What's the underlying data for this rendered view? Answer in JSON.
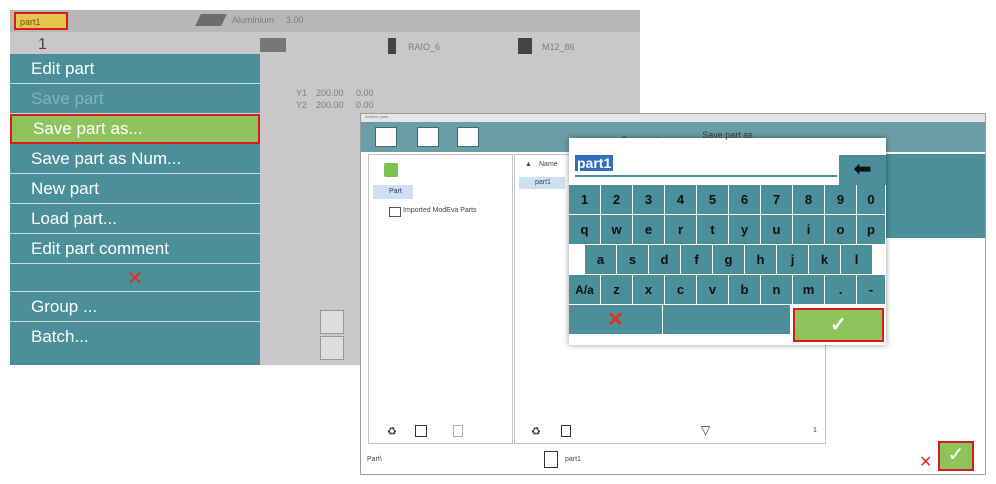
{
  "left": {
    "part_tag": "part1",
    "material_name": "Aluminium",
    "material_thickness": "3.00",
    "tool_radius": "RAIO_6",
    "tool_name": "M12_86",
    "step_number": "1",
    "y1_label": "Y1",
    "y1_value": "200.00",
    "y1_extra": "0.00",
    "y2_label": "Y2",
    "y2_value": "200.00",
    "y2_extra": "0.00",
    "menu": [
      {
        "label": "Edit part",
        "state": "normal"
      },
      {
        "label": "Save part",
        "state": "disabled"
      },
      {
        "label": "Save part as...",
        "state": "selected"
      },
      {
        "label": "Save part as Num...",
        "state": "normal"
      },
      {
        "label": "New part",
        "state": "normal"
      },
      {
        "label": "Load part...",
        "state": "normal"
      },
      {
        "label": "Edit part comment",
        "state": "normal"
      },
      {
        "label": "✕",
        "state": "close"
      },
      {
        "label": "Group ...",
        "state": "normal"
      },
      {
        "label": "Batch...",
        "state": "normal"
      }
    ]
  },
  "right": {
    "window_title": "Archive parts",
    "dialog_title": "Save part as",
    "tree_root": "Part",
    "tree_child": "Imported ModEva Parts",
    "list_header_name": "Name",
    "list_item": "part1",
    "footer_path": "Part\\",
    "footer_file": "part1",
    "page_count": "1"
  },
  "keyboard": {
    "input_value": "part1",
    "row1": [
      "1",
      "2",
      "3",
      "4",
      "5",
      "6",
      "7",
      "8",
      "9",
      "0"
    ],
    "row2": [
      "q",
      "w",
      "e",
      "r",
      "t",
      "y",
      "u",
      "i",
      "o",
      "p"
    ],
    "row3": [
      "a",
      "s",
      "d",
      "f",
      "g",
      "h",
      "j",
      "k",
      "l"
    ],
    "row4": [
      "A/a",
      "z",
      "x",
      "c",
      "v",
      "b",
      "n",
      "m",
      ".",
      "-"
    ],
    "cancel_label": "✕",
    "ok_label": "✓"
  },
  "icons": {
    "backspace": "arrow-left-icon",
    "recycle": "recycle-icon",
    "filter": "filter-icon",
    "trash": "trash-icon"
  },
  "colors": {
    "teal": "#4a8f99",
    "green": "#8fc35b",
    "highlight_red": "#d81c1c",
    "cancel_red": "#e0321f"
  }
}
